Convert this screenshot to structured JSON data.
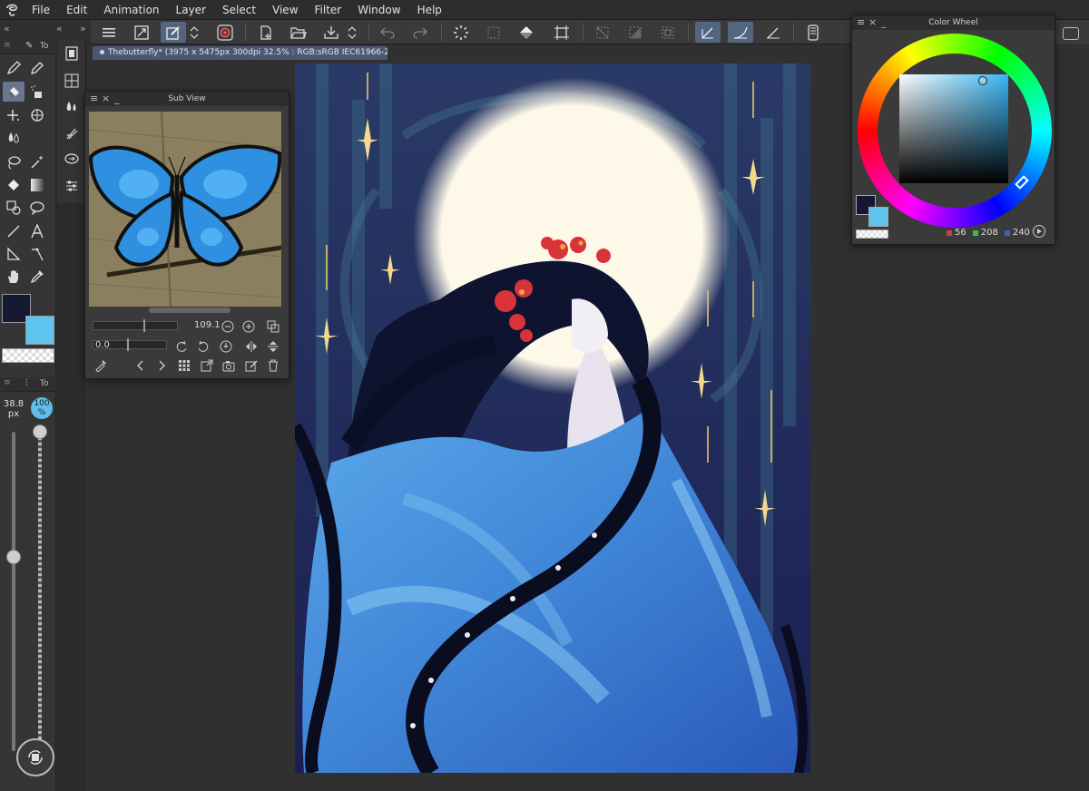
{
  "menubar": {
    "items": [
      "File",
      "Edit",
      "Animation",
      "Layer",
      "Select",
      "View",
      "Filter",
      "Window",
      "Help"
    ]
  },
  "document": {
    "tab_title": "Thebutterfly* (3975 x 5475px 300dpi 32.5% : RGB:sRGB IEC61966-2.1)"
  },
  "tool_palette": {
    "tab_label": "To",
    "property_tab_label": "To",
    "brush_size_value": "38.8",
    "brush_size_unit": "px",
    "opacity_value": "100",
    "opacity_unit": "%"
  },
  "subview": {
    "title": "Sub View",
    "zoom_value": "109.1",
    "rotation_value": "0.0"
  },
  "color_wheel": {
    "title": "Color Wheel",
    "r": "56",
    "g": "208",
    "b": "240",
    "main_color": "#141833",
    "sub_color": "#5cc4ee"
  },
  "icons": {
    "menu": "hamburger-icon",
    "undo": "undo-icon",
    "redo": "redo-icon"
  }
}
